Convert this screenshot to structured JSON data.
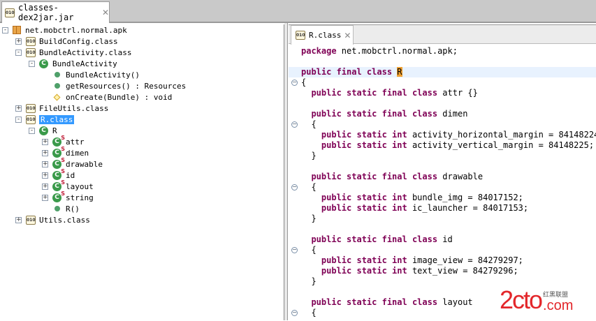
{
  "editor_tab": {
    "title": "classes-dex2jar.jar",
    "icon": "class-file-icon"
  },
  "tree": [
    {
      "label": "net.mobctrl.normal.apk",
      "icon": "package",
      "toggle": "-",
      "indent": 0
    },
    {
      "label": "BuildConfig.class",
      "icon": "classfile",
      "toggle": "+",
      "indent": 1
    },
    {
      "label": "BundleActivity.class",
      "icon": "classfile",
      "toggle": "-",
      "indent": 1
    },
    {
      "label": "BundleActivity",
      "icon": "class",
      "toggle": "-",
      "indent": 2
    },
    {
      "label": "BundleActivity()",
      "icon": "method-public",
      "toggle": "",
      "indent": 3
    },
    {
      "label": "getResources() : Resources",
      "icon": "method-public",
      "toggle": "",
      "indent": 3
    },
    {
      "label": "onCreate(Bundle) : void",
      "icon": "method-protected",
      "toggle": "",
      "indent": 3
    },
    {
      "label": "FileUtils.class",
      "icon": "classfile",
      "toggle": "+",
      "indent": 1
    },
    {
      "label": "R.class",
      "icon": "classfile",
      "toggle": "-",
      "indent": 1,
      "selected": true
    },
    {
      "label": "R",
      "icon": "class",
      "toggle": "-",
      "indent": 2
    },
    {
      "label": "attr",
      "icon": "static-class",
      "toggle": "+",
      "indent": 3
    },
    {
      "label": "dimen",
      "icon": "static-class",
      "toggle": "+",
      "indent": 3
    },
    {
      "label": "drawable",
      "icon": "static-class",
      "toggle": "+",
      "indent": 3
    },
    {
      "label": "id",
      "icon": "static-class",
      "toggle": "+",
      "indent": 3
    },
    {
      "label": "layout",
      "icon": "static-class",
      "toggle": "+",
      "indent": 3
    },
    {
      "label": "string",
      "icon": "static-class",
      "toggle": "+",
      "indent": 3
    },
    {
      "label": "R()",
      "icon": "method-public",
      "toggle": "",
      "indent": 3
    },
    {
      "label": "Utils.class",
      "icon": "classfile",
      "toggle": "+",
      "indent": 1
    }
  ],
  "code_tab": {
    "title": "R.class",
    "icon": "class-file-icon"
  },
  "code": [
    {
      "kw": "package",
      "text": " net.mobctrl.normal.apk;"
    },
    {},
    {
      "kw": "public final class",
      "text": " ",
      "mark": "R",
      "hl": true
    },
    {
      "text": "{",
      "fold": true
    },
    {
      "text": "  ",
      "kw2": "public static final class",
      "text2": " attr {}"
    },
    {},
    {
      "text": "  ",
      "kw2": "public static final class",
      "text2": " dimen"
    },
    {
      "text": "  {",
      "fold": true
    },
    {
      "text": "    ",
      "kw2": "public static int",
      "text2": " activity_horizontal_margin = 84148224;"
    },
    {
      "text": "    ",
      "kw2": "public static int",
      "text2": " activity_vertical_margin = 84148225;"
    },
    {
      "text": "  }"
    },
    {},
    {
      "text": "  ",
      "kw2": "public static final class",
      "text2": " drawable"
    },
    {
      "text": "  {",
      "fold": true
    },
    {
      "text": "    ",
      "kw2": "public static int",
      "text2": " bundle_img = 84017152;"
    },
    {
      "text": "    ",
      "kw2": "public static int",
      "text2": " ic_launcher = 84017153;"
    },
    {
      "text": "  }"
    },
    {},
    {
      "text": "  ",
      "kw2": "public static final class",
      "text2": " id"
    },
    {
      "text": "  {",
      "fold": true
    },
    {
      "text": "    ",
      "kw2": "public static int",
      "text2": " image_view = 84279297;"
    },
    {
      "text": "    ",
      "kw2": "public static int",
      "text2": " text_view = 84279296;"
    },
    {
      "text": "  }"
    },
    {},
    {
      "text": "  ",
      "kw2": "public static final class",
      "text2": " layout"
    },
    {
      "text": "  {",
      "fold": true
    }
  ],
  "watermark": {
    "main": "2cto",
    "cn": "红黑联盟",
    "suffix": ".com"
  },
  "colors": {
    "keyword": "#7f0055",
    "selection": "#3399ff",
    "current_line": "#e8f2fe",
    "match_highlight": "#f0a030"
  }
}
